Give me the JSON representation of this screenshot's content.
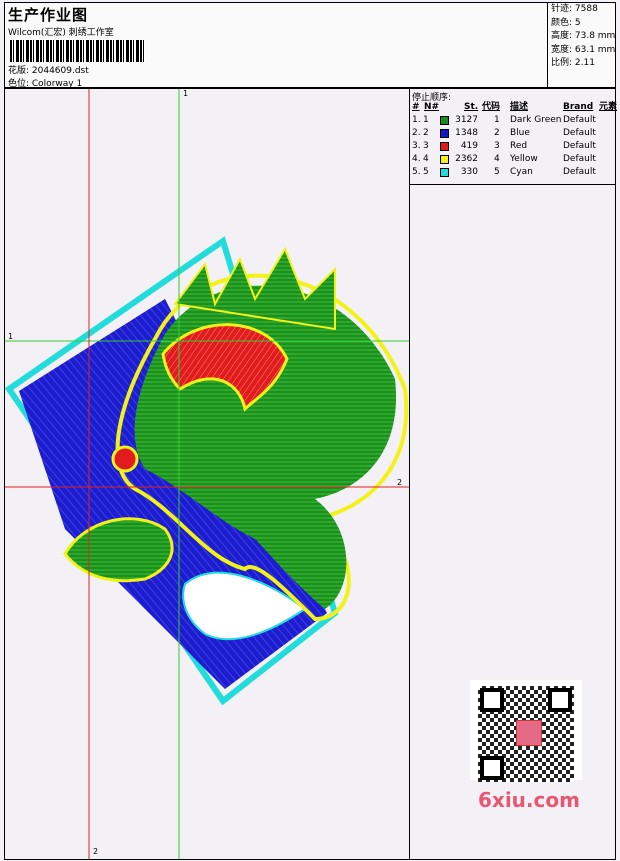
{
  "header": {
    "title": "生产作业图",
    "subtitle": "Wilcom(汇宏) 刺绣工作室",
    "design_label": "花版: 2044609.dst",
    "colorway_label": "色位: Colorway 1"
  },
  "stats": {
    "stitches": "针迹: 7588",
    "colors": "颜色: 5",
    "height": "高度: 73.8 mm",
    "width": "宽度: 63.1 mm",
    "scale": "比例: 2.11"
  },
  "stop_table": {
    "title": "停止顺序:",
    "headers": [
      "#",
      "N#",
      "St.",
      "代码",
      "描述",
      "Brand",
      "元素"
    ],
    "rows": [
      {
        "num": "1.",
        "n": "1",
        "stitches": "3127",
        "code": "1",
        "desc": "Dark Green",
        "brand": "Default",
        "color": "#1a8a1a"
      },
      {
        "num": "2.",
        "n": "2",
        "stitches": "1348",
        "code": "2",
        "desc": "Blue",
        "brand": "Default",
        "color": "#1515c8"
      },
      {
        "num": "3.",
        "n": "3",
        "stitches": "419",
        "code": "3",
        "desc": "Red",
        "brand": "Default",
        "color": "#e01818"
      },
      {
        "num": "4.",
        "n": "4",
        "stitches": "2362",
        "code": "4",
        "desc": "Yellow",
        "brand": "Default",
        "color": "#f2f21a"
      },
      {
        "num": "5.",
        "n": "5",
        "stitches": "330",
        "code": "5",
        "desc": "Cyan",
        "brand": "Default",
        "color": "#22dcdc"
      }
    ]
  },
  "axes": {
    "green_top": "1",
    "green_left": "1",
    "red_right": "2",
    "red_bottom": "2"
  },
  "colors": {
    "green_axis": "#33cc33",
    "red_axis": "#e02020"
  },
  "watermark": "6xiu.com"
}
